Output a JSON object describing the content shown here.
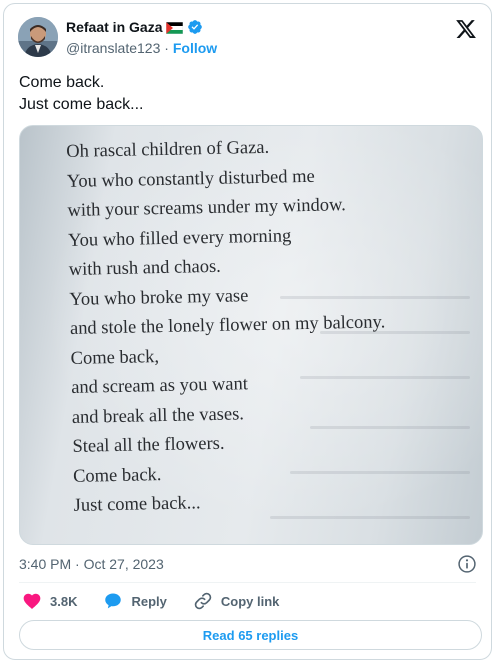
{
  "tweet": {
    "author_name": "Refaat in Gaza",
    "handle": "@itranslate123",
    "separator": "·",
    "follow_label": "Follow",
    "text_lines": [
      "Come back.",
      "Just come back..."
    ],
    "timestamp": "3:40 PM · Oct 27, 2023"
  },
  "media": {
    "poem_lines": [
      "Oh rascal children of Gaza.",
      "You who constantly disturbed me",
      "with your screams under my window.",
      "You who filled every morning",
      "with rush and chaos.",
      "You who broke my vase",
      "and stole the lonely flower on my balcony.",
      "Come back,",
      "and scream as you want",
      "and break all the vases.",
      "Steal all the flowers.",
      "Come back.",
      "Just come back..."
    ]
  },
  "actions": {
    "like_count": "3.8K",
    "reply_label": "Reply",
    "copy_label": "Copy link"
  },
  "read_replies_label": "Read 65 replies",
  "icons": {
    "verified": "verified-badge-icon",
    "flag": "palestine-flag-icon",
    "logo": "x-logo-icon",
    "info": "info-icon",
    "like": "heart-icon",
    "reply": "speech-bubble-icon",
    "copy": "link-icon"
  },
  "colors": {
    "accent": "#1d9bf0",
    "like": "#f91880",
    "muted": "#536471",
    "border": "#cfd9de"
  }
}
